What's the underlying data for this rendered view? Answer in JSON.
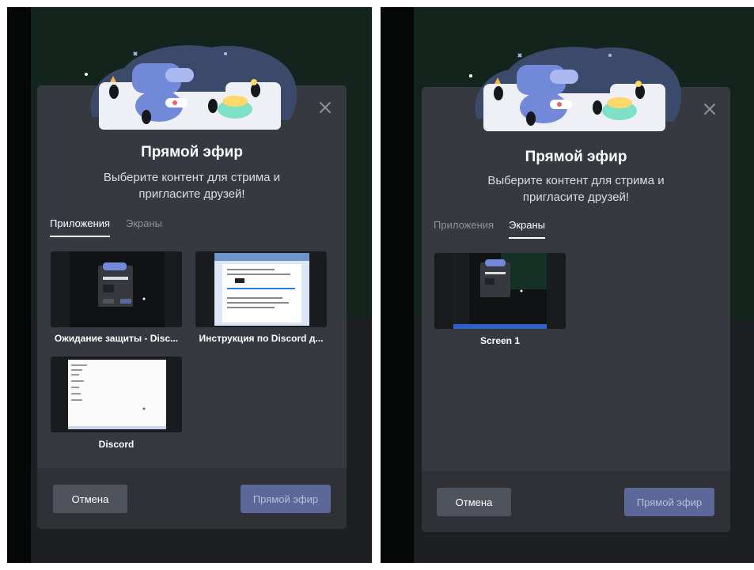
{
  "left": {
    "title": "Прямой эфир",
    "subtitle_line1": "Выберите контент для стрима и",
    "subtitle_line2": "пригласите друзей!",
    "tabs": [
      {
        "label": "Приложения",
        "active": true
      },
      {
        "label": "Экраны",
        "active": false
      }
    ],
    "sources": [
      {
        "label": "Ожидание защиты - Disc..."
      },
      {
        "label": "Инструкция по Discord д..."
      },
      {
        "label": "Discord"
      }
    ],
    "cancel_label": "Отмена",
    "live_label": "Прямой эфир"
  },
  "right": {
    "title": "Прямой эфир",
    "subtitle_line1": "Выберите контент для стрима и",
    "subtitle_line2": "пригласите друзей!",
    "tabs": [
      {
        "label": "Приложения",
        "active": false
      },
      {
        "label": "Экраны",
        "active": true
      }
    ],
    "sources": [
      {
        "label": "Screen 1"
      }
    ],
    "cancel_label": "Отмена",
    "live_label": "Прямой эфир"
  },
  "colors": {
    "modal_bg": "#36393f",
    "footer_bg": "#2f3136",
    "blurple_disabled": "#5c679a",
    "cancel_bg": "#4f545c",
    "backdrop_green": "#13241d"
  }
}
